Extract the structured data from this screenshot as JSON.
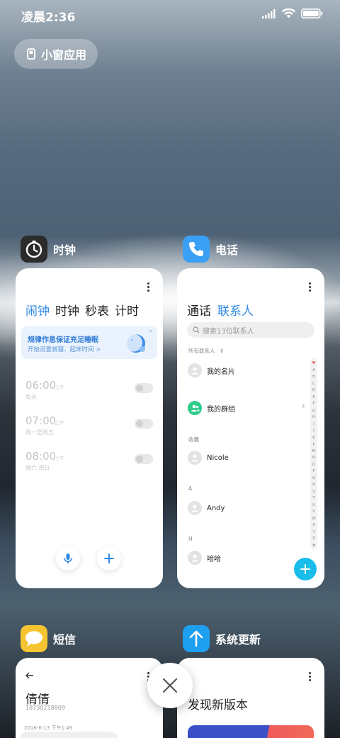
{
  "status_bar": {
    "time": "凌晨2:36"
  },
  "float_window_button": {
    "label": "小窗应用"
  },
  "apps": {
    "clock": {
      "name": "时钟",
      "tabs": [
        "闹钟",
        "时钟",
        "秒表",
        "计时"
      ],
      "active_tab": 0,
      "sleep_banner": {
        "title": "规律作息保证充足睡眠",
        "subtitle": "开始设置就寝、起床时间 >"
      },
      "alarms": [
        {
          "time": "06:00",
          "ampm": "上午",
          "repeat": "每天",
          "enabled": false
        },
        {
          "time": "07:00",
          "ampm": "上午",
          "repeat": "周一至周五",
          "enabled": false
        },
        {
          "time": "08:00",
          "ampm": "上午",
          "repeat": "周六 周日",
          "enabled": false
        }
      ]
    },
    "phone": {
      "name": "电话",
      "tabs": [
        "通话",
        "联系人"
      ],
      "active_tab": 1,
      "search_placeholder": "搜索13位联系人",
      "all_contacts_label": "所有联系人",
      "my_card": "我的名片",
      "my_groups": "我的群组",
      "sections": [
        {
          "label": "收藏",
          "contact": "Nicole"
        },
        {
          "label": "A",
          "contact": "Andy"
        },
        {
          "label": "H",
          "contact": "哈哈"
        }
      ],
      "alphabet": [
        "♥",
        "A",
        "B",
        "C",
        "D",
        "E",
        "F",
        "G",
        "H",
        "I",
        "J",
        "K",
        "L",
        "M",
        "N",
        "O",
        "P",
        "Q",
        "R",
        "S",
        "T",
        "U",
        "V",
        "W",
        "X",
        "Y",
        "Z",
        "#"
      ]
    },
    "sms": {
      "name": "短信",
      "contact_name": "倩倩",
      "contact_number": "18730218809",
      "date": "2016-6-13 下午1:49"
    },
    "update": {
      "name": "系统更新",
      "title": "发现新版本"
    }
  },
  "colors": {
    "accent": "#2e8ae6",
    "fab": "#18bdea",
    "clock_icon_bg": "#2b2b2b",
    "phone_icon_bg": "#3aa0f5",
    "sms_icon_bg": "#f7c431",
    "update_icon_bg": "#1f9ff0"
  }
}
